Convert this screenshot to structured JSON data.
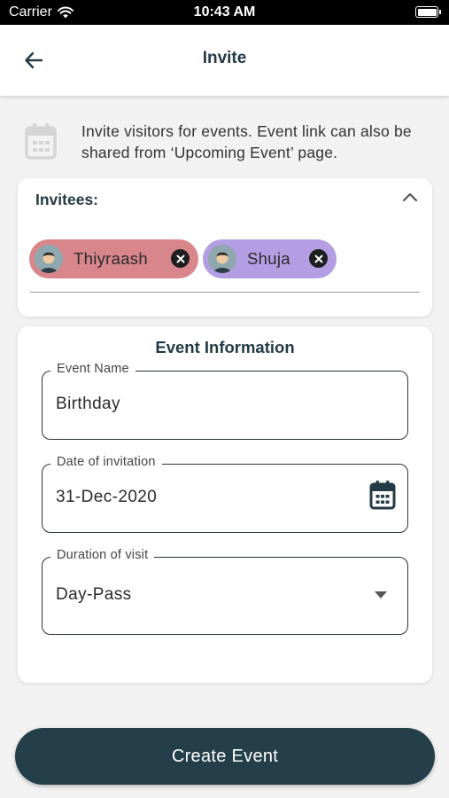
{
  "status_bar": {
    "carrier": "Carrier",
    "time": "10:43 AM"
  },
  "header": {
    "title": "Invite",
    "back_icon": "arrow-left-icon"
  },
  "intro": {
    "icon": "calendar-icon",
    "text": "Invite visitors for events. Event link can also be shared from ‘Upcoming Event’ page."
  },
  "invitees": {
    "label": "Invitees:",
    "collapse_icon": "chevron-up-icon",
    "chips": [
      {
        "name": "Thiyraash",
        "color": "#d8868c"
      },
      {
        "name": "Shuja",
        "color": "#b49ee3"
      }
    ]
  },
  "event_info": {
    "heading": "Event Information",
    "fields": {
      "event_name": {
        "label": "Event Name",
        "value": "Birthday"
      },
      "date": {
        "label": "Date of invitation",
        "value": "31-Dec-2020",
        "icon": "calendar-icon"
      },
      "duration": {
        "label": "Duration of visit",
        "value": "Day-Pass",
        "icon": "dropdown-caret-icon"
      }
    }
  },
  "actions": {
    "create_label": "Create Event",
    "color": "#243f4a"
  }
}
